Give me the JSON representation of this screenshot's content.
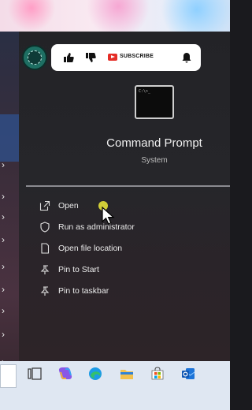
{
  "overlay": {
    "subscribe_label": "SUBSCRIBE",
    "icons": [
      "thumbs-up-icon",
      "thumbs-down-icon",
      "youtube-icon",
      "bell-icon"
    ]
  },
  "app": {
    "icon_text": "C:\\>_",
    "name": "Command Prompt",
    "type": "System"
  },
  "actions": [
    {
      "label": "Open",
      "icon": "open-icon"
    },
    {
      "label": "Run as administrator",
      "icon": "shield-icon"
    },
    {
      "label": "Open file location",
      "icon": "folder-location-icon"
    },
    {
      "label": "Pin to Start",
      "icon": "pin-icon"
    },
    {
      "label": "Pin to taskbar",
      "icon": "pin-icon"
    }
  ],
  "taskbar": {
    "icons": [
      "task-view-icon",
      "copilot-icon",
      "edge-icon",
      "file-explorer-icon",
      "microsoft-store-icon",
      "outlook-icon"
    ]
  },
  "colors": {
    "panel_bg": "#26262a",
    "taskbar_bg": "#dfe7f2",
    "click_highlight": "#e6e23a",
    "subscribe_red": "#e52d27"
  }
}
